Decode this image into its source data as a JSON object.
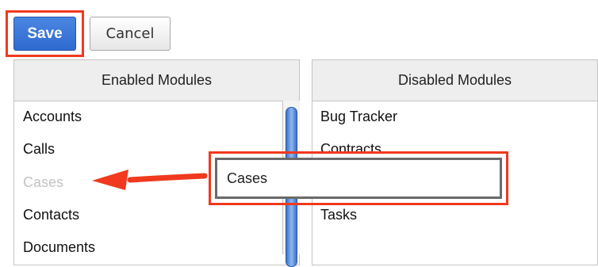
{
  "toolbar": {
    "save_label": "Save",
    "cancel_label": "Cancel"
  },
  "enabled": {
    "header": "Enabled Modules",
    "items": [
      {
        "label": "Accounts",
        "state": "normal"
      },
      {
        "label": "Calls",
        "state": "normal"
      },
      {
        "label": "Cases",
        "state": "placeholder"
      },
      {
        "label": "Contacts",
        "state": "normal"
      },
      {
        "label": "Documents",
        "state": "normal"
      }
    ]
  },
  "disabled": {
    "header": "Disabled Modules",
    "items": [
      "Bug Tracker",
      "Contracts",
      "Tasks"
    ]
  },
  "drag": {
    "label": "Cases"
  },
  "colors": {
    "highlight": "#f0391e",
    "accent": "#2f6ad0",
    "ghost_text": "#c3c3c3"
  },
  "icons": {
    "arrow": "left-arrow-icon"
  }
}
